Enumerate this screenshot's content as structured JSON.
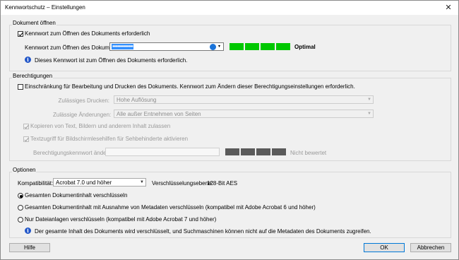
{
  "window": {
    "title": "Kennwortschutz – Einstellungen",
    "close_glyph": "✕"
  },
  "open_doc": {
    "group_label": "Dokument öffnen",
    "require_password_label": "Kennwort zum Öffnen des Dokuments erforderlich",
    "require_password_checked": true,
    "password_label": "Kennwort zum Öffnen des Dokuments:",
    "password_value": "••••••••••••••••",
    "strength_label": "Optimal",
    "strength_color": "#00c800",
    "strength_segments_filled": 4,
    "info_text": "Dieses Kennwort ist zum Öffnen des Dokuments erforderlich."
  },
  "permissions": {
    "group_label": "Berechtigungen",
    "restrict_label": "Einschränkung für Bearbeitung und Drucken des Dokuments. Kennwort zum Ändern dieser Berechtigungseinstellungen erforderlich.",
    "restrict_checked": false,
    "print_label": "Zulässiges Drucken:",
    "print_value": "Hohe Auflösung",
    "changes_label": "Zulässige Änderungen:",
    "changes_value": "Alle außer Entnehmen von Seiten",
    "copy_label": "Kopieren von Text, Bildern und anderem Inhalt zulassen",
    "screenreader_label": "Textzugriff für Bildschirmlesehilfen für Sehbehinderte aktivieren",
    "change_pw_label": "Berechtigungskennwort ändern:",
    "strength_label": "Nicht bewertet",
    "strength_color_empty": "#5a5a5a"
  },
  "options": {
    "group_label": "Optionen",
    "compat_label": "Kompatibilität:",
    "compat_value": "Acrobat 7.0 und höher",
    "encryption_label": "Verschlüsselungsebene:",
    "encryption_value": "128-Bit AES",
    "radio_all": "Gesamten Dokumentinhalt verschlüsseln",
    "radio_except_meta": "Gesamten Dokumentinhalt mit Ausnahme von Metadaten verschlüsseln (kompatibel mit Adobe Acrobat 6 und höher)",
    "radio_attachments": "Nur Dateianlagen verschlüsseln (kompatibel mit Adobe Acrobat 7 und höher)",
    "selected_radio": "all",
    "info_text": "Der gesamte Inhalt des Dokuments wird verschlüsselt, und Suchmaschinen können nicht auf die Metadaten des Dokuments zugreifen."
  },
  "footer": {
    "help_label": "Hilfe",
    "ok_label": "OK",
    "cancel_label": "Abbrechen"
  }
}
